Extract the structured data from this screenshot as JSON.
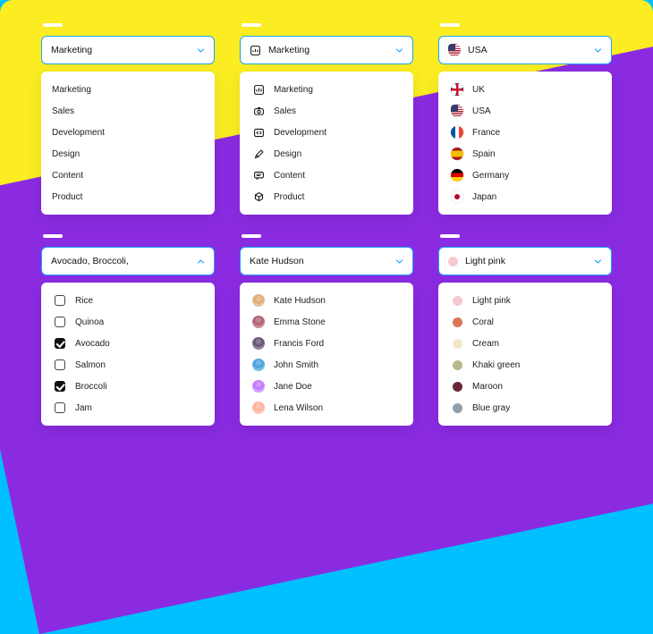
{
  "dropdowns": {
    "basic": {
      "selected": "Marketing",
      "options": [
        "Marketing",
        "Sales",
        "Development",
        "Design",
        "Content",
        "Product"
      ]
    },
    "with_icons": {
      "selected": "Marketing",
      "options": [
        {
          "label": "Marketing",
          "icon": "chart-icon"
        },
        {
          "label": "Sales",
          "icon": "camera-icon"
        },
        {
          "label": "Development",
          "icon": "code-icon"
        },
        {
          "label": "Design",
          "icon": "pen-icon"
        },
        {
          "label": "Content",
          "icon": "chat-icon"
        },
        {
          "label": "Product",
          "icon": "cube-icon"
        }
      ]
    },
    "countries": {
      "selected": "USA",
      "selected_flag": "us",
      "options": [
        {
          "label": "UK",
          "flag": "uk"
        },
        {
          "label": "USA",
          "flag": "us"
        },
        {
          "label": "France",
          "flag": "fr"
        },
        {
          "label": "Spain",
          "flag": "es"
        },
        {
          "label": "Germany",
          "flag": "de"
        },
        {
          "label": "Japan",
          "flag": "jp"
        }
      ]
    },
    "multiselect": {
      "selected_text": "Avocado, Broccoli,",
      "options": [
        {
          "label": "Rice",
          "checked": false
        },
        {
          "label": "Quinoa",
          "checked": false
        },
        {
          "label": "Avocado",
          "checked": true
        },
        {
          "label": "Salmon",
          "checked": false
        },
        {
          "label": "Broccoli",
          "checked": true
        },
        {
          "label": "Jam",
          "checked": false
        }
      ]
    },
    "people": {
      "selected": "Kate Hudson",
      "options": [
        {
          "label": "Kate Hudson",
          "avatar": "#e1b07e"
        },
        {
          "label": "Emma Stone",
          "avatar": "#b56576"
        },
        {
          "label": "Francis Ford",
          "avatar": "#6d597a"
        },
        {
          "label": "John Smith",
          "avatar": "#4ea8de"
        },
        {
          "label": "Jane Doe",
          "avatar": "#c77dff"
        },
        {
          "label": "Lena Wilson",
          "avatar": "#ffb4a2"
        }
      ]
    },
    "colors": {
      "selected": "Light pink",
      "selected_color": "#f7c8cf",
      "options": [
        {
          "label": "Light pink",
          "color": "#f7c8cf"
        },
        {
          "label": "Coral",
          "color": "#d97757"
        },
        {
          "label": "Cream",
          "color": "#f5e6c8"
        },
        {
          "label": "Khaki green",
          "color": "#b8b88a"
        },
        {
          "label": "Maroon",
          "color": "#6b2737"
        },
        {
          "label": "Blue gray",
          "color": "#8ea0ab"
        }
      ]
    }
  },
  "flags": {
    "uk": {
      "bg": "#ffffff",
      "overlay": "linear-gradient(#012169,#012169)",
      "stripes": true
    },
    "us": {
      "style": "repeating-linear-gradient(#b22234 0 1.2px,#fff 1.2px 2.4px)",
      "canton": "#3c3b6e"
    },
    "fr": {
      "style": "linear-gradient(90deg,#0055a4 34%,#fff 34% 66%,#ef4135 66%)"
    },
    "es": {
      "style": "linear-gradient(#aa151b 25%,#f1bf00 25% 75%,#aa151b 75%)"
    },
    "de": {
      "style": "linear-gradient(#000 33%,#dd0000 33% 66%,#ffce00 66%)"
    },
    "jp": {
      "bg": "#fff",
      "dot": "#bc002d"
    }
  }
}
